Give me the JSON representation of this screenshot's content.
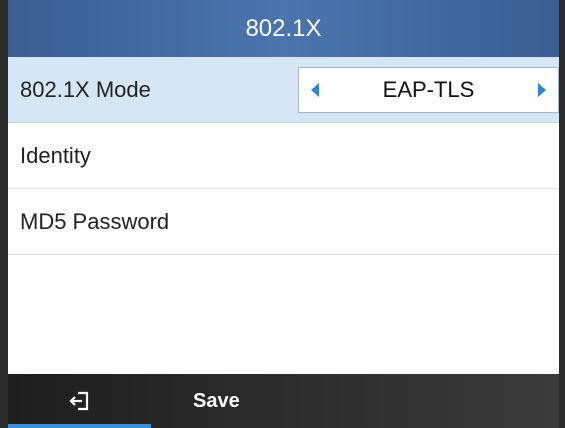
{
  "header": {
    "title": "802.1X"
  },
  "settings": [
    {
      "label": "802.1X Mode",
      "value": "EAP-TLS"
    },
    {
      "label": "Identity"
    },
    {
      "label": "MD5 Password"
    }
  ],
  "softkeys": {
    "back_icon": "back-exit-icon",
    "save_label": "Save"
  },
  "colors": {
    "title_bar": "#4a75ad",
    "selected_row": "#d5e6f5",
    "arrow_accent": "#2a86d4",
    "softkey_bar": "#2e2e2e",
    "softkey_highlight": "#3d8fd8"
  }
}
